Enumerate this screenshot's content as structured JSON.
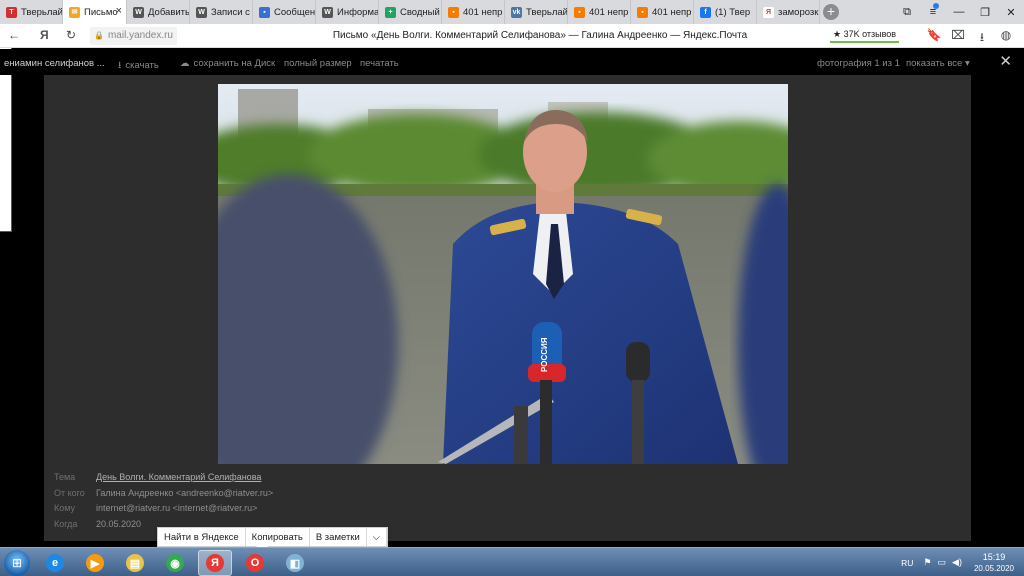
{
  "tabs": [
    {
      "label": "Тверьлайф",
      "color": "#d32f2f",
      "glyph": "Т",
      "active": false
    },
    {
      "label": "Письмо",
      "color": "#f5a623",
      "glyph": "✉",
      "active": true
    },
    {
      "label": "Добавить",
      "color": "#555555",
      "glyph": "W",
      "active": false
    },
    {
      "label": "Записи с",
      "color": "#555555",
      "glyph": "W",
      "active": false
    },
    {
      "label": "Сообщения",
      "color": "#3b6ed1",
      "glyph": "▪",
      "active": false
    },
    {
      "label": "Информация",
      "color": "#555555",
      "glyph": "W",
      "active": false
    },
    {
      "label": "Сводный",
      "color": "#1fa463",
      "glyph": "+",
      "active": false
    },
    {
      "label": "401 непр",
      "color": "#f57c00",
      "glyph": "▪",
      "active": false
    },
    {
      "label": "Тверьлайф",
      "color": "#4a76a8",
      "glyph": "vk",
      "active": false
    },
    {
      "label": "401 непр",
      "color": "#f57c00",
      "glyph": "▪",
      "active": false
    },
    {
      "label": "401 непр",
      "color": "#f57c00",
      "glyph": "▪",
      "active": false
    },
    {
      "label": "(1) Твер",
      "color": "#1877f2",
      "glyph": "f",
      "active": false
    },
    {
      "label": "заморозки",
      "color": "#ffffff",
      "glyph": "Я",
      "active": false
    }
  ],
  "address": {
    "back": "←",
    "yandex_logo": "Я",
    "reload": "↻",
    "url": "mail.yandex.ru",
    "title": "Письмо «День Волги. Комментарий Селифанова» — Галина Андреенко — Яндекс.Почта",
    "reviews": "★ 37K отзывов",
    "tab_close": "×"
  },
  "viewer_toolbar": {
    "filename": "ениамин селифанов ...",
    "download": "скачать",
    "save_to_disk": "сохранить на Диск",
    "full_size": "полный размер",
    "print": "печатать",
    "counter": "фотография 1 из 1",
    "show_all": "показать все ▾",
    "close": "✕"
  },
  "meta": {
    "subject_label": "Тема",
    "subject": "День Волги. Комментарий Селифанова",
    "from_label": "От кого",
    "from": "Галина Андреенко <andreenko@riatver.ru>",
    "to_label": "Кому",
    "to": "internet@riatver.ru <internet@riatver.ru>",
    "date_label": "Когда",
    "date": "20.05.2020"
  },
  "photo": {
    "mic_label": "РОССИЯ"
  },
  "context_menu": {
    "find": "Найти в Яндексе",
    "copy": "Копировать",
    "notes": "В заметки",
    "more": "⌵"
  },
  "taskbar": {
    "lang": "RU",
    "time": "15:19",
    "date": "20.05.2020",
    "apps": [
      {
        "name": "ie",
        "glyph": "e",
        "color": "#1e88e5",
        "active": false
      },
      {
        "name": "media",
        "glyph": "▶",
        "color": "#f39c12",
        "active": false
      },
      {
        "name": "explorer",
        "glyph": "▤",
        "color": "#e8c34a",
        "active": false
      },
      {
        "name": "chrome",
        "glyph": "◉",
        "color": "#34a853",
        "active": false
      },
      {
        "name": "yandex",
        "glyph": "Я",
        "color": "#e53935",
        "active": true
      },
      {
        "name": "opera",
        "glyph": "O",
        "color": "#e53935",
        "active": false
      },
      {
        "name": "notes",
        "glyph": "◧",
        "color": "#7fb3d5",
        "active": false
      }
    ]
  }
}
